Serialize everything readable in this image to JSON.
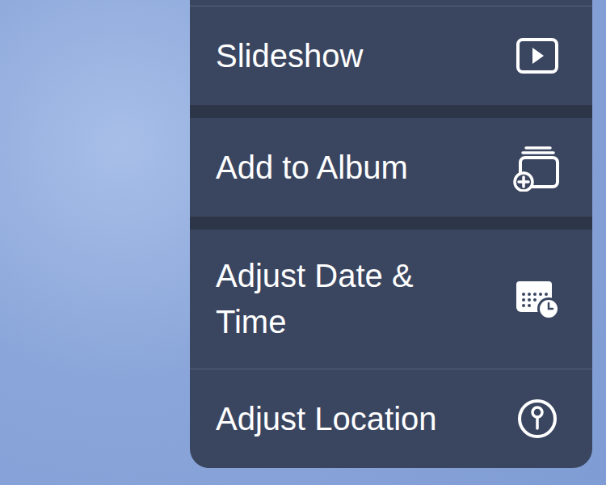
{
  "photo": {
    "kind": "sky"
  },
  "menu": {
    "groups": [
      {
        "items": [
          {
            "label": "Slideshow"
          }
        ]
      },
      {
        "items": [
          {
            "label": "Add to Album"
          }
        ]
      },
      {
        "items": [
          {
            "label": "Adjust Date & Time"
          },
          {
            "label": "Adjust Location"
          }
        ]
      }
    ]
  }
}
